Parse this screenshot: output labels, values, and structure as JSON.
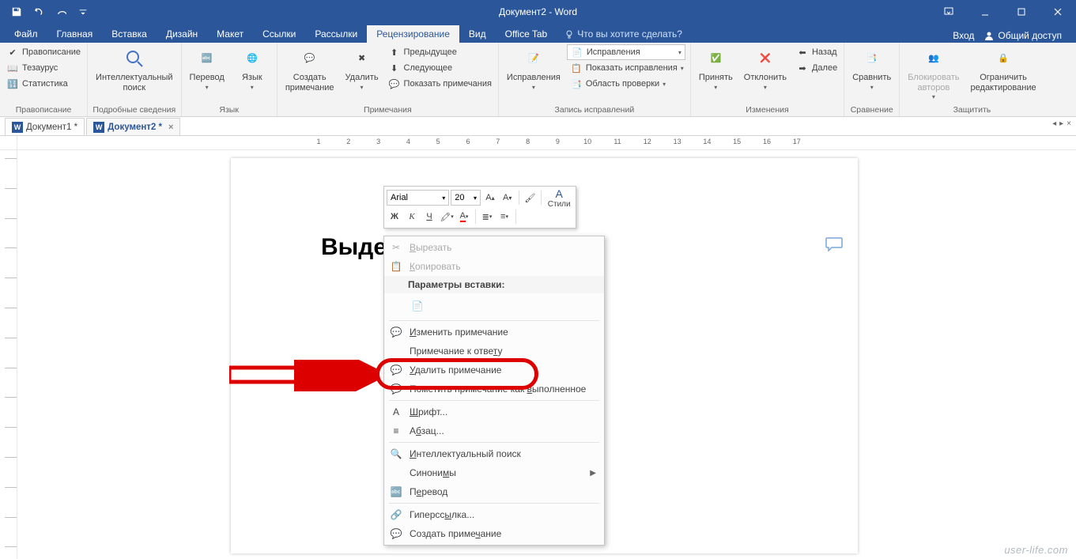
{
  "title": "Документ2 - Word",
  "qat": [
    "save-icon",
    "undo-icon",
    "redo-icon",
    "customize-icon"
  ],
  "menutabs": [
    {
      "label": "Файл"
    },
    {
      "label": "Главная"
    },
    {
      "label": "Вставка"
    },
    {
      "label": "Дизайн"
    },
    {
      "label": "Макет"
    },
    {
      "label": "Ссылки"
    },
    {
      "label": "Рассылки"
    },
    {
      "label": "Рецензирование",
      "active": true
    },
    {
      "label": "Вид"
    },
    {
      "label": "Office Tab"
    }
  ],
  "tellme": "Что вы хотите сделать?",
  "right_menu": {
    "signin": "Вход",
    "share": "Общий доступ"
  },
  "ribbon": {
    "proofing": {
      "spelling": "Правописание",
      "thesaurus": "Тезаурус",
      "wordcount": "Статистика",
      "label": "Правописание"
    },
    "insights": {
      "smartlookup": "Интеллектуальный\nпоиск",
      "label": "Подробные сведения"
    },
    "language": {
      "translate": "Перевод",
      "language": "Язык",
      "label": "Язык"
    },
    "comments": {
      "new": "Создать\nпримечание",
      "delete": "Удалить",
      "previous": "Предыдущее",
      "next": "Следующее",
      "show": "Показать примечания",
      "label": "Примечания"
    },
    "tracking": {
      "track": "Исправления",
      "combo": "Исправления",
      "showmarkup": "Показать исправления",
      "panel": "Область проверки",
      "label": "Запись исправлений"
    },
    "changes": {
      "accept": "Принять",
      "reject": "Отклонить",
      "back": "Назад",
      "forward": "Далее",
      "label": "Изменения"
    },
    "compare": {
      "compare": "Сравнить",
      "label": "Сравнение"
    },
    "protect": {
      "block": "Блокировать\nавторов",
      "restrict": "Ограничить\nредактирование",
      "label": "Защитить"
    }
  },
  "doctabs": [
    {
      "label": "Документ1 *",
      "active": false
    },
    {
      "label": "Документ2 *",
      "active": true
    }
  ],
  "document_text": "Выделенный текст",
  "minitoolbar": {
    "font": "Arial",
    "size": "20",
    "styles": "Стили",
    "bold": "Ж",
    "italic": "К",
    "underline": "Ч"
  },
  "context_menu": {
    "cut": "Вырезать",
    "copy": "Копировать",
    "paste_options": "Параметры вставки:",
    "edit_comment": "Изменить примечание",
    "reply_comment": "Примечание к ответу",
    "delete_comment": "Удалить примечание",
    "mark_done": "Пометить примечание как выполненное",
    "font": "Шрифт...",
    "paragraph": "Абзац...",
    "smart_lookup": "Интеллектуальный поиск",
    "synonyms": "Синонимы",
    "translate": "Перевод",
    "hyperlink": "Гиперссылка...",
    "new_comment": "Создать примечание"
  },
  "ruler_numbers": [
    1,
    2,
    3,
    4,
    5,
    6,
    7,
    8,
    9,
    10,
    11,
    12,
    13,
    14,
    15,
    16,
    17
  ],
  "watermark": "user-life.com"
}
